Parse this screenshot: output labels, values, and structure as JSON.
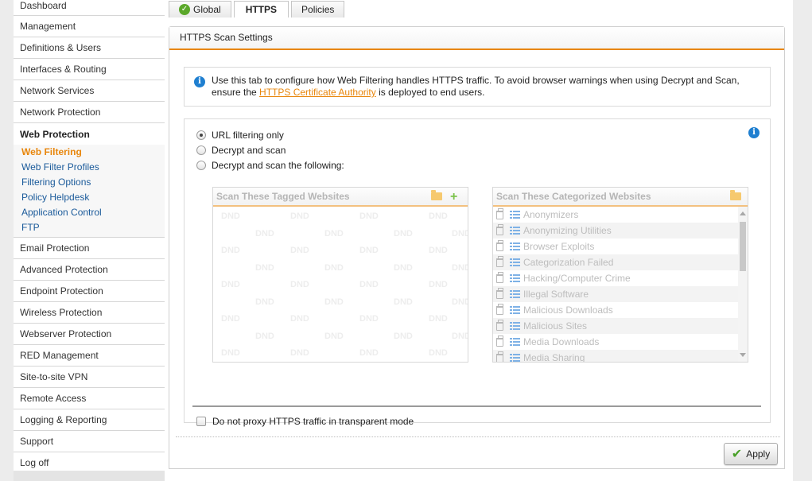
{
  "sidebar": {
    "items_top": [
      "Dashboard",
      "Management",
      "Definitions & Users",
      "Interfaces & Routing",
      "Network Services",
      "Network Protection"
    ],
    "active_section": "Web Protection",
    "sub_items": [
      "Web Filtering",
      "Web Filter Profiles",
      "Filtering Options",
      "Policy Helpdesk",
      "Application Control",
      "FTP"
    ],
    "current_sub": "Web Filtering",
    "items_bottom": [
      "Email Protection",
      "Advanced Protection",
      "Endpoint Protection",
      "Wireless Protection",
      "Webserver Protection",
      "RED Management",
      "Site-to-site VPN",
      "Remote Access",
      "Logging & Reporting",
      "Support",
      "Log off"
    ]
  },
  "tabs": [
    {
      "label": "Global",
      "status_icon": "ok-check-icon"
    },
    {
      "label": "HTTPS",
      "active": true
    },
    {
      "label": "Policies"
    }
  ],
  "panel": {
    "title": "HTTPS Scan Settings",
    "info_text_1": "Use this tab to configure how Web Filtering handles HTTPS traffic. To avoid browser warnings when using Decrypt and Scan,",
    "info_text_2a": "ensure the ",
    "info_link": "HTTPS Certificate Authority",
    "info_text_2b": " is deployed to end users.",
    "radios": [
      {
        "label": "URL filtering only",
        "checked": true
      },
      {
        "label": "Decrypt and scan",
        "checked": false
      },
      {
        "label": "Decrypt and scan the following:",
        "checked": false
      }
    ],
    "tagged_list": {
      "title": "Scan These Tagged Websites",
      "placeholder": "DND"
    },
    "categorized_list": {
      "title": "Scan These Categorized Websites",
      "items": [
        "Anonymizers",
        "Anonymizing Utilities",
        "Browser Exploits",
        "Categorization Failed",
        "Hacking/Computer Crime",
        "Illegal Software",
        "Malicious Downloads",
        "Malicious Sites",
        "Media Downloads",
        "Media Sharing"
      ]
    },
    "checkbox_label": "Do not proxy HTTPS traffic in transparent mode",
    "checkbox_checked": false,
    "apply_label": "Apply"
  },
  "colors": {
    "accent": "#e8860b",
    "link": "#1a5a9a",
    "info": "#1f7fd0",
    "ok": "#5ba82a"
  }
}
